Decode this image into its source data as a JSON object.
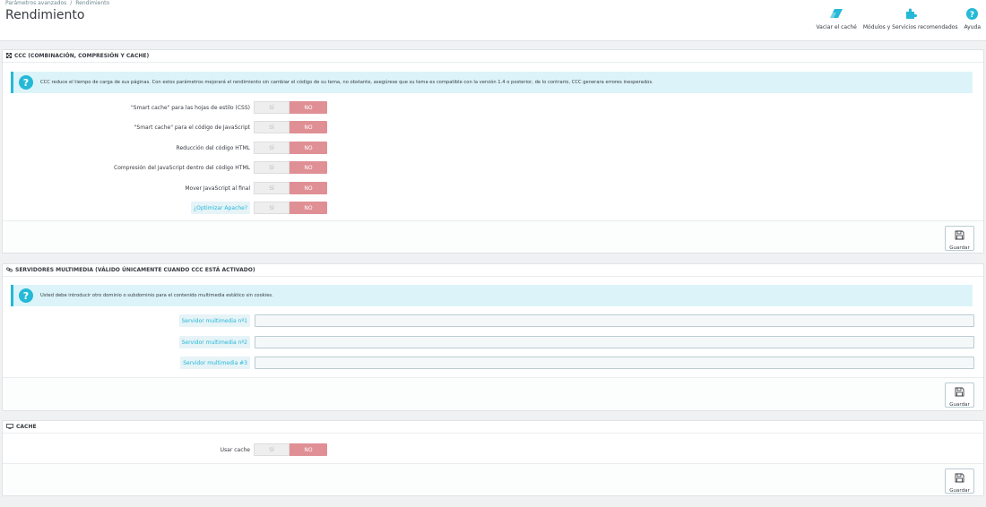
{
  "breadcrumb": {
    "parent": "Parámetros avanzados",
    "separator": "/",
    "current": "Rendimiento"
  },
  "page_title": "Rendimiento",
  "toolbar": {
    "clear_cache": {
      "label": "Vaciar el caché",
      "icon": "eraser-icon"
    },
    "modules": {
      "label": "Módulos y Servicios recomendados",
      "icon": "puzzle-icon"
    },
    "help": {
      "label": "Ayuda",
      "icon": "help-icon"
    }
  },
  "colors": {
    "accent": "#25b9d7",
    "switch_no": "#e08f95",
    "alert_bg": "#dcf4f9"
  },
  "ccc_panel": {
    "title": "CCC (COMBINACIÓN, COMPRESIÓN Y CACHE)",
    "icon": "fullscreen-icon",
    "alert": "CCC reduce el tiempo de carga de sus páginas. Con estos parámetros mejorará el rendimiento sin cambiar el código de su tema, no obstante, asegúrese que su tema es compatible con la versión 1.4 o posterior, de lo contrario, CCC generara errores inesperados.",
    "options": [
      {
        "label": "\"Smart cache\" para las hojas de estilo (CSS)",
        "yes": "SÍ",
        "no": "NO",
        "value": "NO"
      },
      {
        "label": "\"Smart cache\" para el código de JavaScript",
        "yes": "SÍ",
        "no": "NO",
        "value": "NO"
      },
      {
        "label": "Reducción del código HTML",
        "yes": "SÍ",
        "no": "NO",
        "value": "NO"
      },
      {
        "label": "Compresión del JavaScript dentro del código HTML",
        "yes": "SÍ",
        "no": "NO",
        "value": "NO"
      },
      {
        "label": "Mover JavaScript al final",
        "yes": "SÍ",
        "no": "NO",
        "value": "NO"
      },
      {
        "label": "¿Optimizar Apache?",
        "yes": "SÍ",
        "no": "NO",
        "value": "NO"
      }
    ],
    "save_label": "Guardar"
  },
  "media_panel": {
    "title": "SERVIDORES MULTIMEDIA (VÁLIDO ÚNICAMENTE CUANDO CCC ESTÁ ACTIVADO)",
    "icon": "link-icon",
    "alert": "Usted debe introducir otro dominio o subdominio para el contenido multimedia estático sin cookies.",
    "servers": [
      {
        "label": "Servidor multimedia nº1",
        "value": ""
      },
      {
        "label": "Servidor multimedia nº2",
        "value": ""
      },
      {
        "label": "Servidor multimedia #3",
        "value": ""
      }
    ],
    "save_label": "Guardar"
  },
  "cache_panel": {
    "title": "CACHE",
    "icon": "desktop-icon",
    "option": {
      "label": "Usar cache",
      "yes": "SÍ",
      "no": "NO",
      "value": "NO"
    },
    "save_label": "Guardar"
  }
}
